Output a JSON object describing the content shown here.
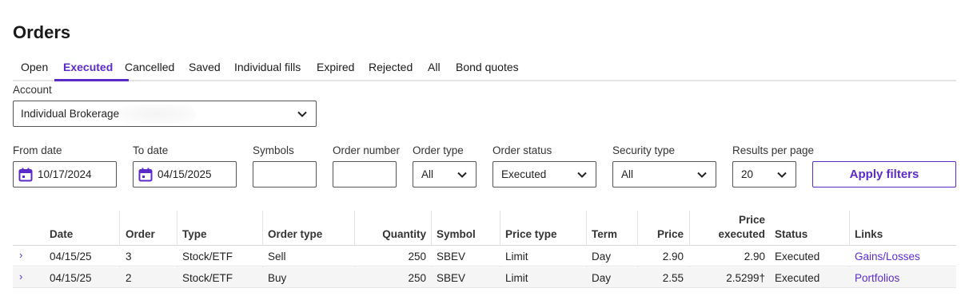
{
  "page": {
    "title": "Orders"
  },
  "tabs": [
    "Open",
    "Executed",
    "Cancelled",
    "Saved",
    "Individual fills",
    "Expired",
    "Rejected",
    "All",
    "Bond quotes"
  ],
  "active_tab": "Executed",
  "account": {
    "label": "Account",
    "value": "Individual Brokerage"
  },
  "filters": {
    "from_date": {
      "label": "From date",
      "value": "10/17/2024"
    },
    "to_date": {
      "label": "To date",
      "value": "04/15/2025"
    },
    "symbols": {
      "label": "Symbols",
      "value": ""
    },
    "order_number": {
      "label": "Order number",
      "value": ""
    },
    "order_type": {
      "label": "Order type",
      "value": "All"
    },
    "order_status": {
      "label": "Order status",
      "value": "Executed"
    },
    "security_type": {
      "label": "Security type",
      "value": "All"
    },
    "results_per_page": {
      "label": "Results per page",
      "value": "20"
    },
    "apply_label": "Apply filters"
  },
  "table": {
    "headers": {
      "date": "Date",
      "order": "Order",
      "type": "Type",
      "order_type": "Order type",
      "quantity": "Quantity",
      "symbol": "Symbol",
      "price_type": "Price type",
      "term": "Term",
      "price": "Price",
      "price_executed_line1": "Price",
      "price_executed_line2": "executed",
      "status": "Status",
      "links": "Links"
    },
    "rows": [
      {
        "expand": "›",
        "date": "04/15/25",
        "order": "3",
        "type": "Stock/ETF",
        "order_type": "Sell",
        "quantity": "250",
        "symbol": "SBEV",
        "price_type": "Limit",
        "term": "Day",
        "price": "2.90",
        "price_executed": "2.90",
        "status": "Executed",
        "link": "Gains/Losses"
      },
      {
        "expand": "›",
        "date": "04/15/25",
        "order": "2",
        "type": "Stock/ETF",
        "order_type": "Buy",
        "quantity": "250",
        "symbol": "SBEV",
        "price_type": "Limit",
        "term": "Day",
        "price": "2.55",
        "price_executed": "2.5299†",
        "status": "Executed",
        "link": "Portfolios"
      }
    ]
  },
  "colors": {
    "accent": "#5b2bc9",
    "border": "#555555",
    "row_alt": "#f5f5f5"
  },
  "icons": {
    "calendar": "calendar-icon",
    "chevron": "chevron-down-icon",
    "expand": "chevron-right-icon"
  }
}
